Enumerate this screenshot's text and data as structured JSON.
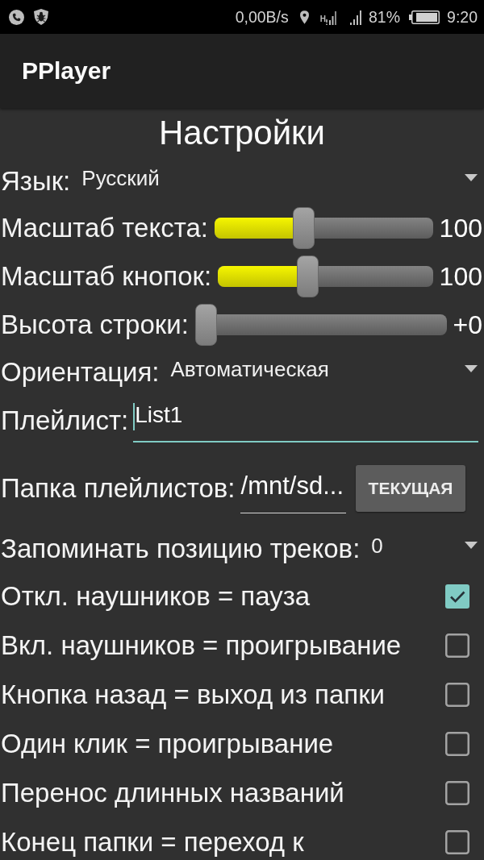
{
  "status_bar": {
    "network_speed": "0,00B/s",
    "network_type": "H",
    "battery": "81%",
    "time": "9:20"
  },
  "app_bar": {
    "title": "PPlayer"
  },
  "settings": {
    "title": "Настройки",
    "rows": [
      {
        "kind": "dropdown",
        "label": "Язык:",
        "value": "Русский"
      },
      {
        "kind": "slider",
        "label": "Масштаб текста:",
        "level": 0.4,
        "reading": "100"
      },
      {
        "kind": "slider",
        "label": "Масштаб кнопок:",
        "level": 0.41,
        "reading": "100"
      },
      {
        "kind": "slider",
        "label": "Высота строки:",
        "level": 0,
        "reading": "+0"
      },
      {
        "kind": "dropdown",
        "label": "Ориентация:",
        "value": "Автоматическая"
      },
      {
        "kind": "text_input",
        "label": "Плейлист:",
        "value": "List1",
        "focused": true
      },
      {
        "kind": "folder_input",
        "label": "Папка плейлистов:",
        "value": "/mnt/sd...",
        "focused": false,
        "button": "ТЕКУЩАЯ"
      },
      {
        "kind": "dropdown",
        "label": "Запоминать позицию треков:",
        "value": "0"
      },
      {
        "kind": "checkbox",
        "label": "Откл. наушников = пауза",
        "checked": true
      },
      {
        "kind": "checkbox",
        "label": "Вкл. наушников = проигрывание",
        "checked": false
      },
      {
        "kind": "checkbox",
        "label": "Кнопка назад = выход из папки",
        "checked": false
      },
      {
        "kind": "checkbox",
        "label": "Один клик = проигрывание",
        "checked": false
      },
      {
        "kind": "checkbox",
        "label": "Перенос длинных названий",
        "checked": false
      },
      {
        "kind": "checkbox",
        "label": "Конец папки = переход к",
        "checked": false
      }
    ]
  }
}
